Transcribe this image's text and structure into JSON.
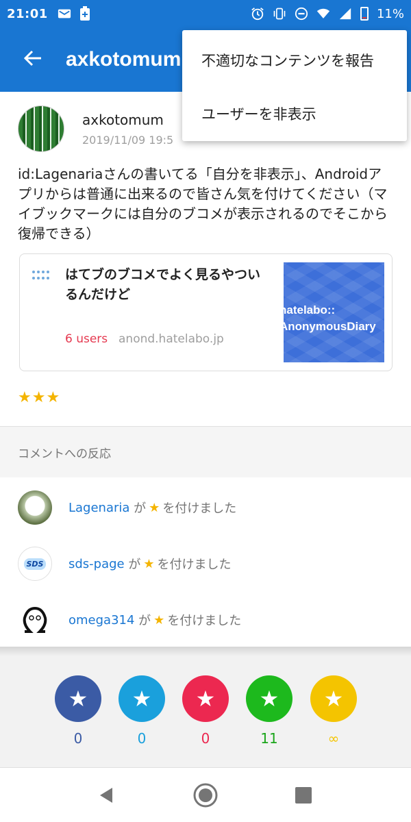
{
  "status_bar": {
    "time": "21:01",
    "battery": "11%",
    "icons": [
      "message-icon",
      "battery-plus-icon",
      "alarm-icon",
      "vibrate-icon",
      "dnd-icon",
      "wifi-icon",
      "signal-icon",
      "battery-icon"
    ]
  },
  "app_bar": {
    "title": "axkotomum",
    "back_icon": "arrow-left-icon"
  },
  "menu": {
    "items": [
      {
        "label": "不適切なコンテンツを報告"
      },
      {
        "label": "ユーザーを非表示"
      }
    ]
  },
  "post": {
    "author": "axkotomum",
    "date": "2019/11/09 19:5",
    "comment": "id:Lagenariaさんの書いてる「自分を非表示」、Androidアプリからは普通に出来るので皆さん気を付けてください（マイブックマークには自分のブコメが表示されるのでそこから復帰できる）",
    "stars": "★★★",
    "link_card": {
      "title": "はてブのブコメでよく見るやついるんだけど",
      "users": "6 users",
      "domain": "anond.hatelabo.jp",
      "thumb_line1": "hatelabo::",
      "thumb_line2": "AnonymousDiary"
    }
  },
  "reactions_section": {
    "header": "コメントへの反応",
    "items": [
      {
        "user": "Lagenaria",
        "ga": "が",
        "star": "★",
        "action": "を付けました"
      },
      {
        "user": "sds-page",
        "ga": "が",
        "star": "★",
        "action": "を付けました",
        "avatar_text": "SDS"
      },
      {
        "user": "omega314",
        "ga": "が",
        "star": "★",
        "action": "を付けました"
      }
    ]
  },
  "star_panel": {
    "buttons": [
      {
        "color": "#3b5ba5",
        "count": "0",
        "count_color": "#3b5ba5"
      },
      {
        "color": "#1aa0dc",
        "count": "0",
        "count_color": "#1aa0dc"
      },
      {
        "color": "#ec2850",
        "count": "0",
        "count_color": "#ec2850"
      },
      {
        "color": "#1db91d",
        "count": "11",
        "count_color": "#1aa51a"
      },
      {
        "color": "#f4c400",
        "count": "∞",
        "count_color": "#f4c400"
      }
    ]
  },
  "nav_bar": {
    "icons": [
      "back-triangle-icon",
      "home-circle-icon",
      "recents-square-icon"
    ]
  }
}
